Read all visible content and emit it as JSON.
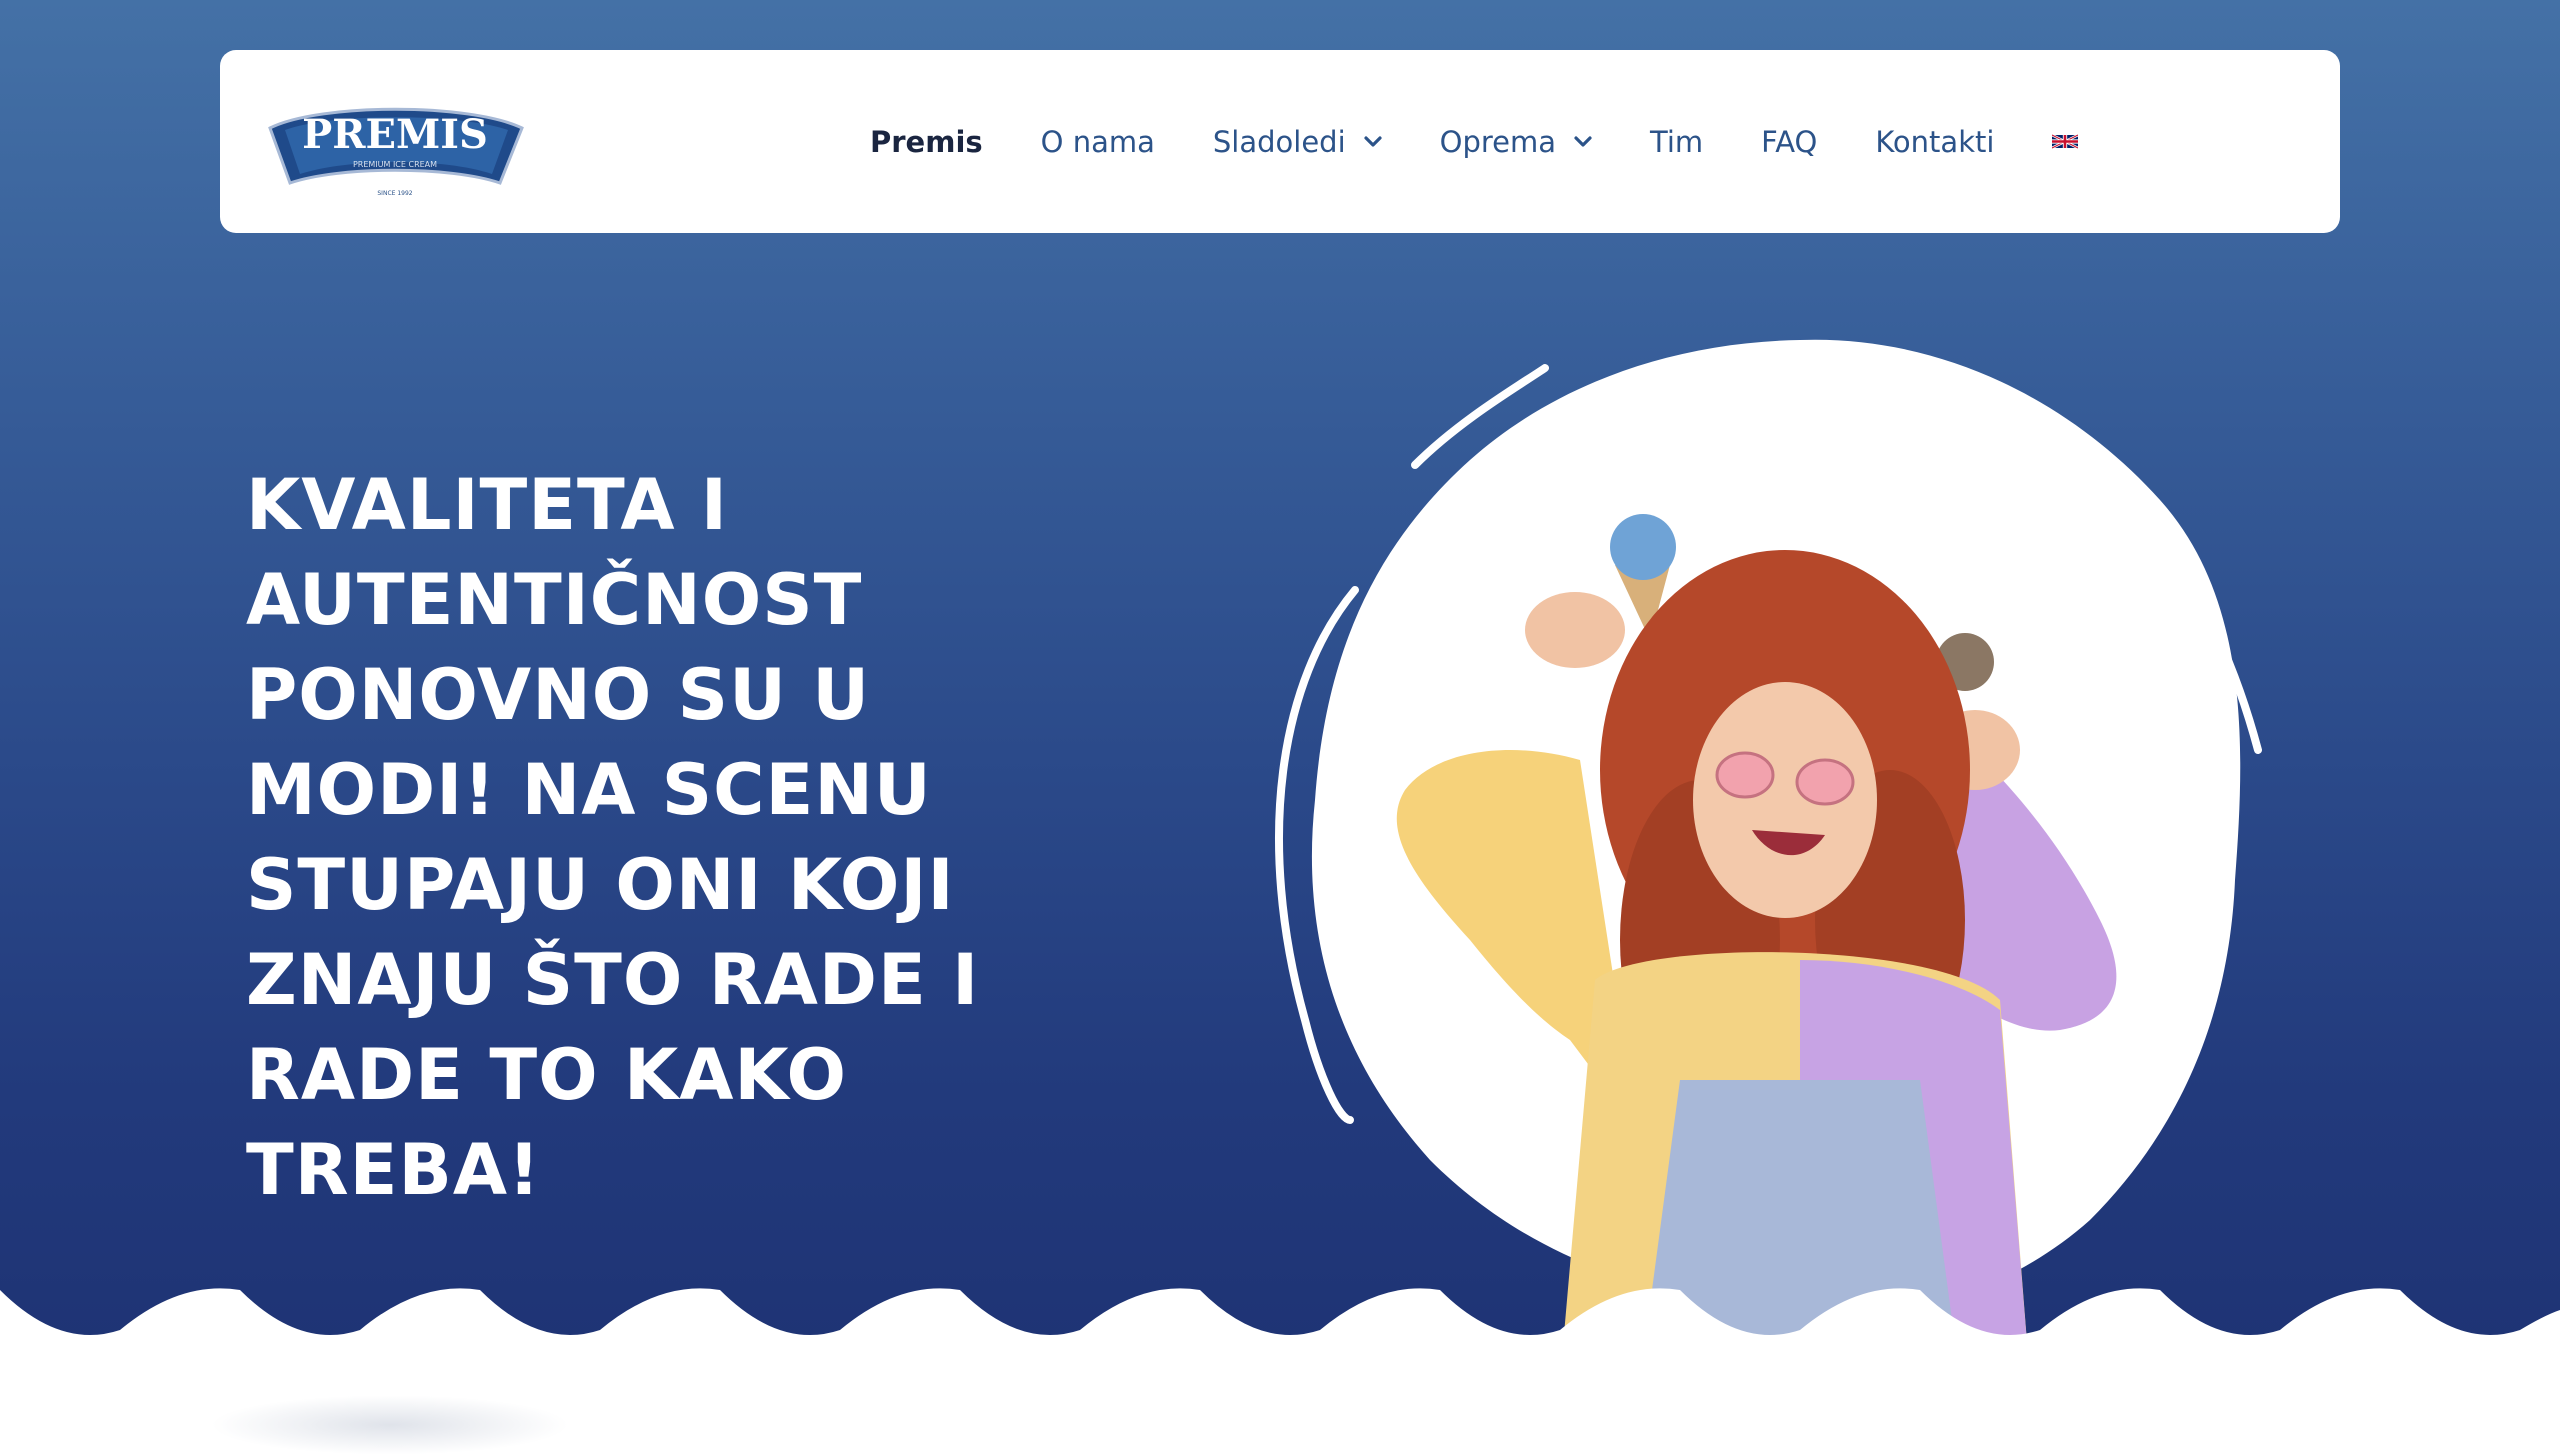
{
  "brand": {
    "logo_text": "PREMIS",
    "logo_tagline": "PREMIUM ICE CREAM",
    "logo_since": "SINCE 1992",
    "color_primary": "#2c5389",
    "color_dark": "#1e3374"
  },
  "nav": {
    "items": [
      {
        "label": "Premis",
        "active": true
      },
      {
        "label": "O nama"
      },
      {
        "label": "Sladoledi",
        "dropdown": true
      },
      {
        "label": "Oprema",
        "dropdown": true
      },
      {
        "label": "Tim"
      },
      {
        "label": "FAQ"
      },
      {
        "label": "Kontakti"
      }
    ],
    "language_icon": "uk-flag-icon"
  },
  "hero": {
    "headline": "KVALITETA I AUTENTIČNOST PONOVNO SU U MODI! NA SCENU STUPAJU ONI KOJI ZNAJU ŠTO RADE I RADE TO KAKO TREBA!"
  }
}
